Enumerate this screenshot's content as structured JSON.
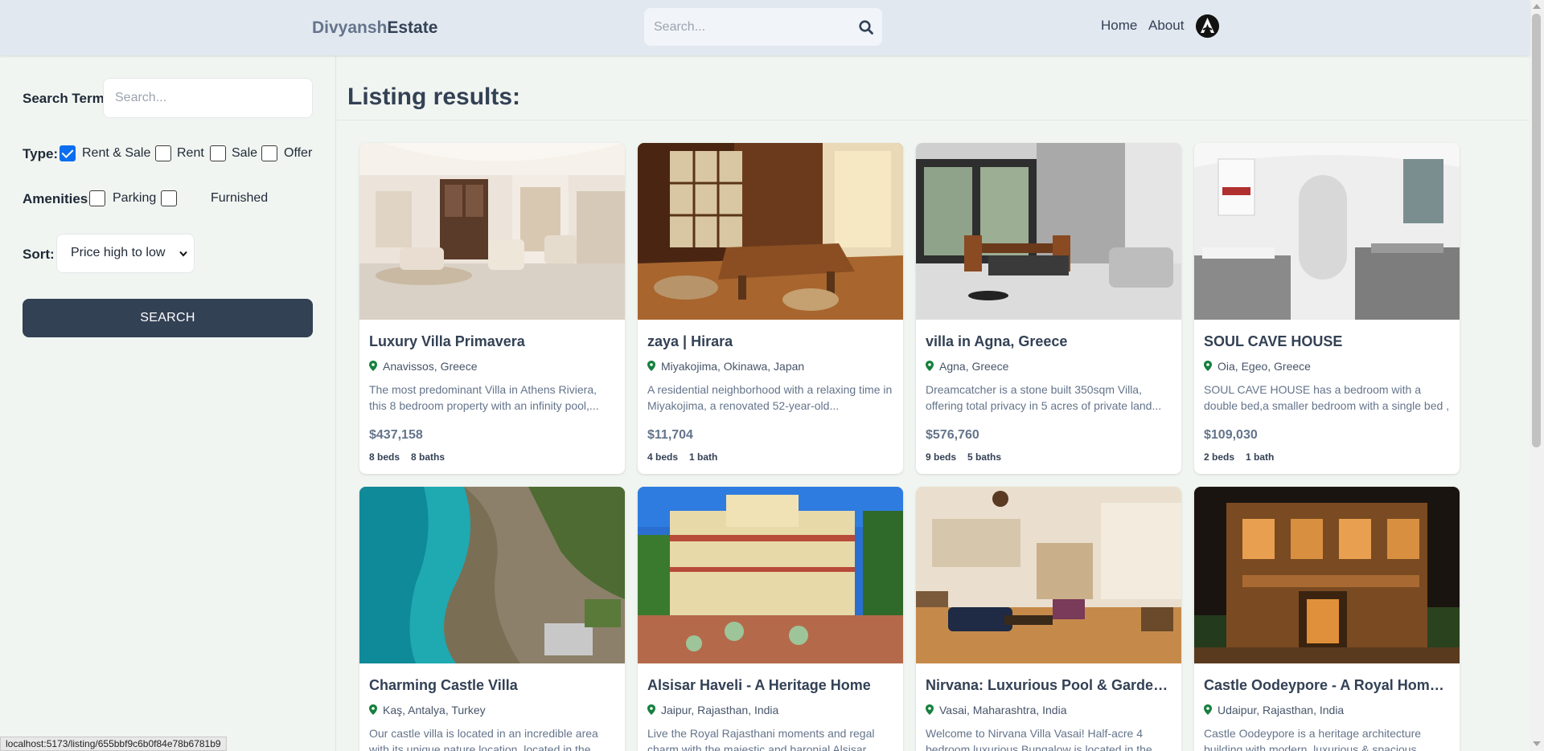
{
  "header": {
    "logo_part1": "Divyansh",
    "logo_part2": "Estate",
    "search_placeholder": "Search...",
    "nav": {
      "home": "Home",
      "about": "About"
    }
  },
  "sidebar": {
    "search_term_label": "Search Term:",
    "search_term_placeholder": "Search...",
    "type_label": "Type:",
    "types": [
      {
        "label": "Rent & Sale",
        "checked": true
      },
      {
        "label": "Rent",
        "checked": false
      },
      {
        "label": "Sale",
        "checked": false
      },
      {
        "label": "Offer",
        "checked": false
      }
    ],
    "amenities_label": "Amenities:",
    "amenities": [
      {
        "label": "Parking",
        "checked": false
      },
      {
        "label": "Furnished",
        "checked": false
      }
    ],
    "sort_label": "Sort:",
    "sort_value": "Price high to low",
    "search_button": "SEARCH"
  },
  "main": {
    "title": "Listing results:",
    "listings": [
      {
        "name": "Luxury Villa Primavera",
        "location": "Anavissos, Greece",
        "description": "The most predominant Villa in Athens Riviera, this 8 bedroom property with an infinity pool,...",
        "price": "$437,158",
        "beds": "8 beds",
        "baths": "8 baths"
      },
      {
        "name": "zaya | Hirara",
        "location": "Miyakojima, Okinawa, Japan",
        "description": "A residential neighborhood with a relaxing time in Miyakojima, a renovated 52-year-old...",
        "price": "$11,704",
        "beds": "4 beds",
        "baths": "1 bath"
      },
      {
        "name": "villa in Agna, Greece",
        "location": "Agna, Greece",
        "description": "Dreamcatcher is a stone built 350sqm Villa, offering total privacy in 5 acres of private land...",
        "price": "$576,760",
        "beds": "9 beds",
        "baths": "5 baths"
      },
      {
        "name": "SOUL CAVE HOUSE",
        "location": "Oia, Egeo, Greece",
        "description": "SOUL CAVE HOUSE has a bedroom with a double bed,a smaller bedroom with a single bed , a...",
        "price": "$109,030",
        "beds": "2 beds",
        "baths": "1 bath"
      },
      {
        "name": "Charming Castle Villa",
        "location": "Kaş, Antalya, Turkey",
        "description": "Our castle villa is located in an incredible area with its unique nature location, located in the",
        "price": "",
        "beds": "",
        "baths": ""
      },
      {
        "name": "Alsisar Haveli - A Heritage Home",
        "location": "Jaipur, Rajasthan, India",
        "description": "Live the Royal Rajasthani moments and regal charm with the majestic and baronial Alsisar",
        "price": "",
        "beds": "",
        "baths": ""
      },
      {
        "name": "Nirvana: Luxurious Pool & Garden Villa",
        "location": "Vasai, Maharashtra, India",
        "description": "Welcome to Nirvana Villa Vasai! Half-acre 4 bedroom luxurious Bungalow is located in the",
        "price": "",
        "beds": "",
        "baths": ""
      },
      {
        "name": "Castle Oodeypore - A Royal Homestay",
        "location": "Udaipur, Rajasthan, India",
        "description": "Castle Oodeypore is a heritage architecture building with modern, luxurious & spacious",
        "price": "",
        "beds": "",
        "baths": ""
      }
    ]
  },
  "status_bar": {
    "url": "localhost:5173/listing/655bbf9c6b0f84e78b6781b9"
  },
  "colors": {
    "header_bg": "#e2e8f0",
    "page_bg": "#f1f5f1",
    "button_bg": "#334155",
    "checkbox_checked": "#0b6ef0",
    "pin": "#15803d"
  }
}
